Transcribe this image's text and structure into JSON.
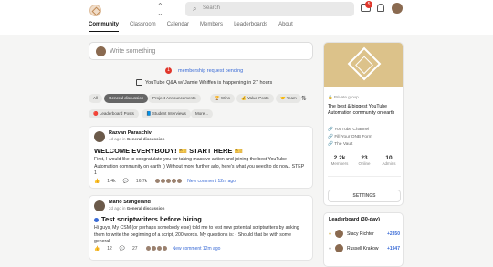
{
  "header": {
    "search_placeholder": "Search",
    "chat_badge": "5",
    "tabs": [
      "Community",
      "Classroom",
      "Calendar",
      "Members",
      "Leaderboards",
      "About"
    ]
  },
  "composer": {
    "placeholder": "Write something"
  },
  "pending": {
    "count": "1",
    "text": "membership request pending"
  },
  "event": {
    "text": "YouTube Q&A w/ Jamie Whiffen is happening in 27 hours"
  },
  "filters": [
    "All",
    "General discussion",
    "Project Announcements",
    "🏆 Wins",
    "💰 Value Posts",
    "🤝 Team",
    "🔴 Leaderboard Posts",
    "📘 Student Interviews",
    "More..."
  ],
  "posts": [
    {
      "author": "Razvan Paraschiv",
      "meta_time": "4d ago in",
      "meta_category": "General discussion",
      "title": "WELCOME EVERYBODY! 🎫 START HERE 🎫",
      "body": "First, I would like to congratulate you for taking massive action and joining the best YouTube Automation community on earth :) Without more further ado, here's what you need to do now.. STEP 1",
      "likes": "1.4k",
      "comments": "16.7k",
      "new_comment": "New comment 12m ago"
    },
    {
      "author": "Mario Stangeland",
      "meta_time": "2d ago in",
      "meta_category": "General discussion",
      "title": "Test scriptwriters before hiring",
      "body": "Hi guys, My CSM (or perhaps somebody else) told me to test new potential scriptwriters by asking them to write the beginning of a script, 200 words. My questions is: - Should that be with some general",
      "likes": "12",
      "comments": "27",
      "new_comment": "New comment 12m ago"
    }
  ],
  "sidebar": {
    "private": "Private group",
    "description": "The best & biggest YouTube Automation community on earth",
    "links": [
      "YouTube Channel",
      "Fill Your ONB Form",
      "The Vault"
    ],
    "stats": [
      {
        "value": "2.2k",
        "label": "Members"
      },
      {
        "value": "23",
        "label": "Online"
      },
      {
        "value": "10",
        "label": "Admins"
      }
    ],
    "settings": "SETTINGS"
  },
  "leaderboard": {
    "title": "Leaderboard (30-day)",
    "rows": [
      {
        "name": "Stacy Richter",
        "points": "+2350"
      },
      {
        "name": "Russell Krakow",
        "points": "+1947"
      }
    ]
  },
  "colors": {
    "accent": "#3a6bd6",
    "banner": "#dcc28a",
    "badge": "#e0362b"
  }
}
